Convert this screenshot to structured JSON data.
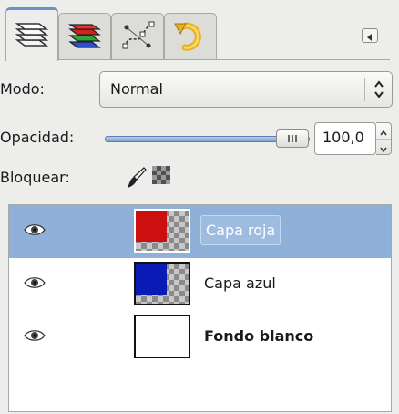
{
  "tabs": [
    {
      "icon": "layers-icon",
      "active": true
    },
    {
      "icon": "channels-icon",
      "active": false
    },
    {
      "icon": "paths-icon",
      "active": false
    },
    {
      "icon": "undo-history-icon",
      "active": false
    }
  ],
  "controls": {
    "mode_label": "Modo:",
    "mode_value": "Normal",
    "opacity_label": "Opacidad:",
    "opacity_value": "100,0",
    "opacity_percent": 100,
    "lock_label": "Bloquear:"
  },
  "layers": [
    {
      "name": "Capa roja",
      "color": "#cc0f0f",
      "selected": true,
      "bold": false
    },
    {
      "name": "Capa azul",
      "color": "#0a1ab4",
      "selected": false,
      "bold": false
    },
    {
      "name": "Fondo blanco",
      "color": "#ffffff",
      "selected": false,
      "bold": true
    }
  ],
  "colors": {
    "selection": "#8fb0d9",
    "accent": "#6a90c4"
  }
}
